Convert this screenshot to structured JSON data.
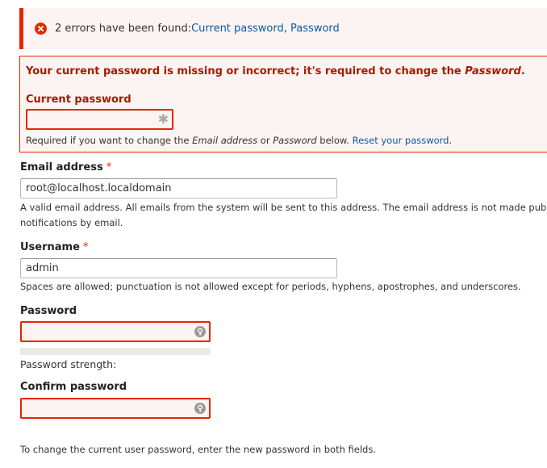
{
  "error_banner": {
    "text": "2 errors have been found: ",
    "link_current_password": "Current password",
    "separator": ",",
    "link_password": "Password"
  },
  "current_password": {
    "error_message": "Your current password is missing or incorrect; it's required to change the ",
    "error_message_em": "Password",
    "error_message_end": ".",
    "label": "Current password",
    "description_prefix": "Required if you want to change the ",
    "description_em1": "Email address",
    "description_or": " or ",
    "description_em2": "Password",
    "description_suffix": " below. ",
    "reset_link": "Reset your password",
    "description_end": "."
  },
  "email": {
    "label": "Email address",
    "required_mark": "*",
    "value": "root@localhost.localdomain",
    "description_line1": "A valid email address. All emails from the system will be sent to this address. The email address is not made public",
    "description_line2": "notifications by email."
  },
  "username": {
    "label": "Username",
    "required_mark": "*",
    "value": "admin",
    "description": "Spaces are allowed; punctuation is not allowed except for periods, hyphens, apostrophes, and underscores."
  },
  "password": {
    "label": "Password",
    "strength_label": "Password strength:"
  },
  "confirm_password": {
    "label": "Confirm password"
  },
  "footer_description": "To change the current user password, enter the new password in both fields.",
  "colors": {
    "error": "#e62600",
    "error_bg": "#fcf4f2",
    "link": "#0a5aa8"
  }
}
